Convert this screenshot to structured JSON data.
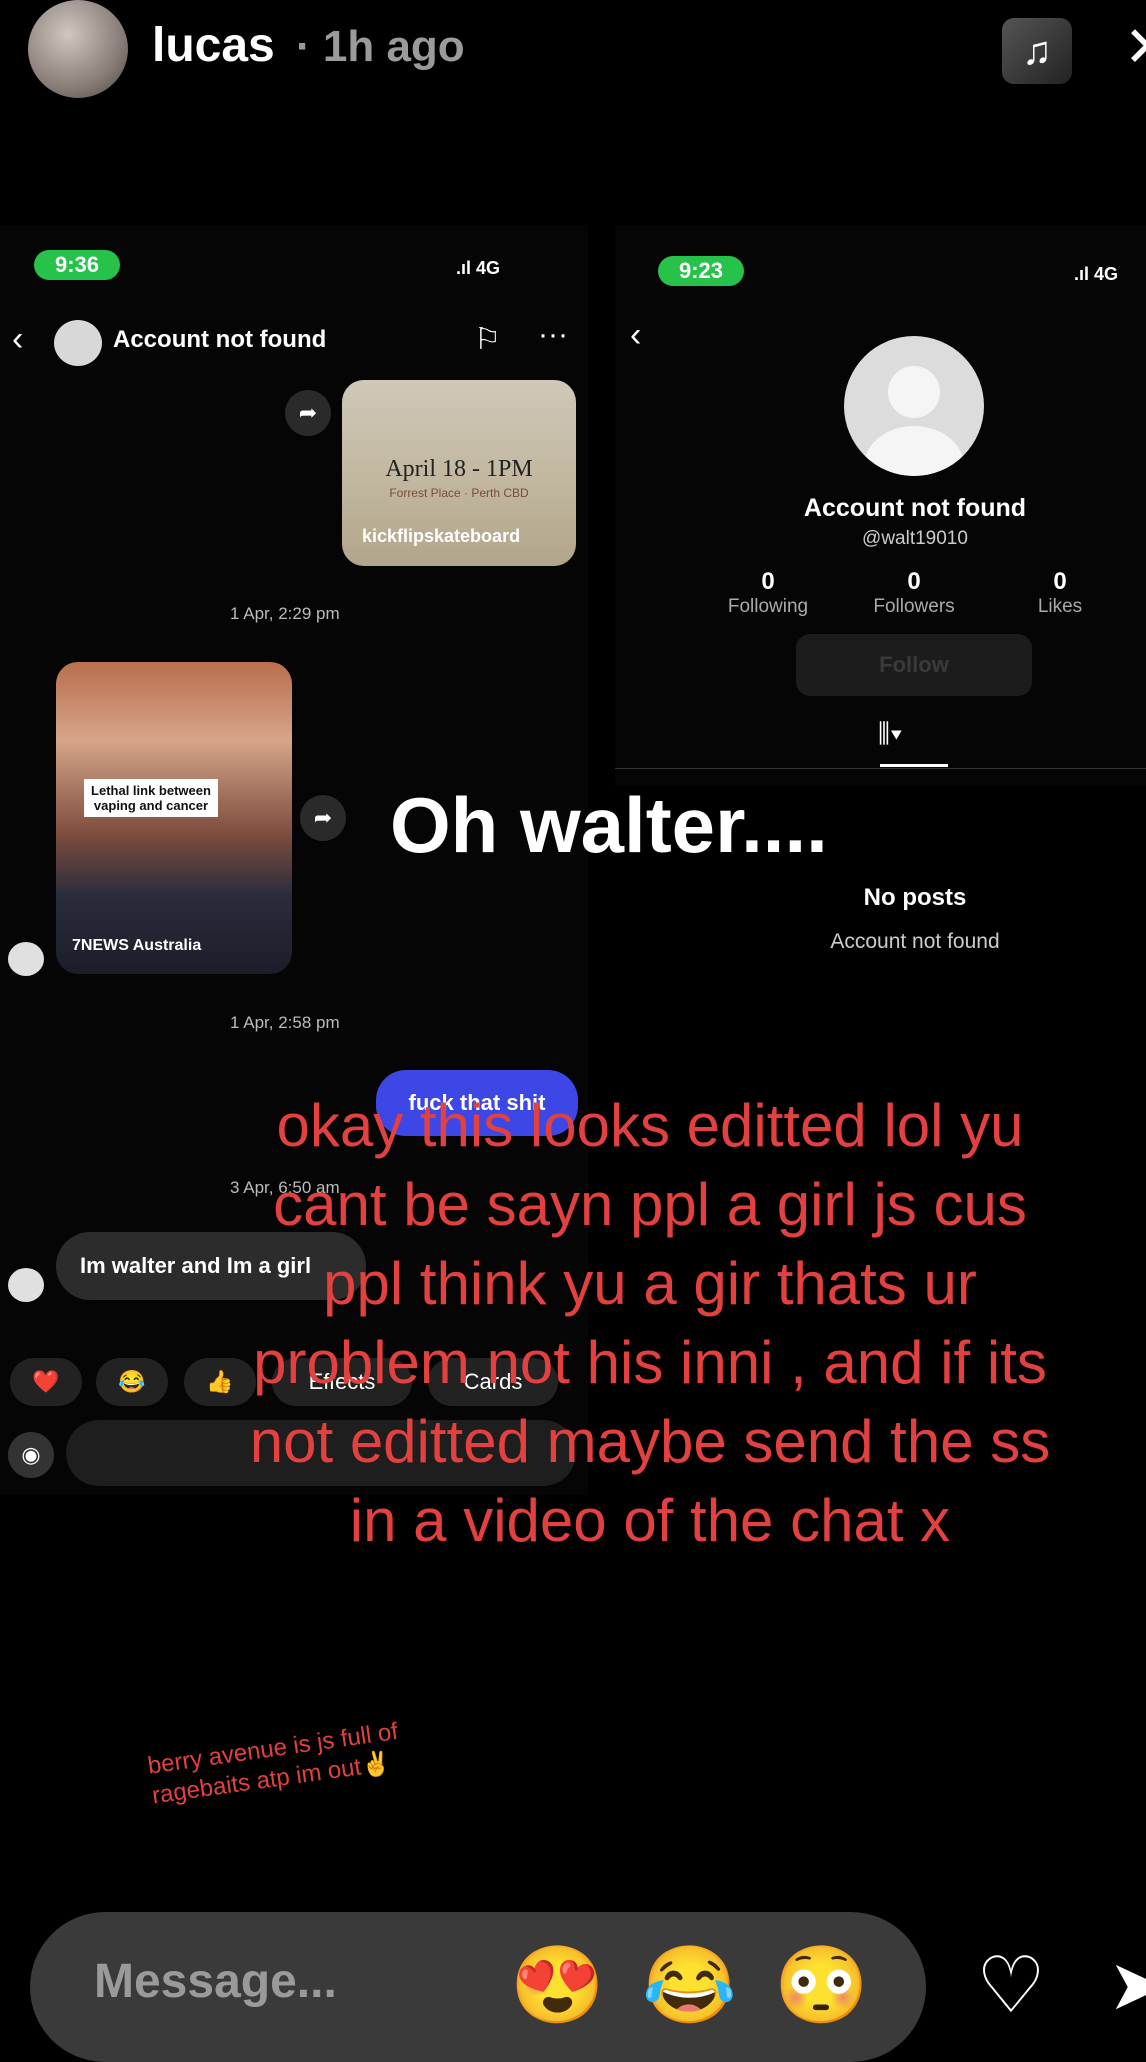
{
  "header": {
    "username": "lucas",
    "time": "· 1h ago",
    "music_icon": "music-note-icon",
    "close_icon": "close-icon"
  },
  "left_screenshot": {
    "status_time": "9:36",
    "status_signal": ".ıl 4G",
    "chat_title": "Account not found",
    "card1": {
      "event": "April 18 - 1PM",
      "place": "Forrest Place · Perth CBD",
      "handle": "kickflipskateboard"
    },
    "timestamp1": "1 Apr, 2:29 pm",
    "card2": {
      "caption": "Lethal link between vaping and cancer",
      "source": "7NEWS Australia"
    },
    "timestamp2": "1 Apr, 2:58 pm",
    "sent_message": "fuck that shit",
    "timestamp3": "3 Apr, 6:50 am",
    "received_message": "Im walter and Im a girl",
    "reactions": [
      "❤️",
      "😂",
      "👍",
      "Effects",
      "Cards"
    ]
  },
  "right_screenshot": {
    "status_time": "9:23",
    "status_signal": ".ıl 4G",
    "name": "Account not found",
    "handle": "@walt19010",
    "stats": [
      {
        "n": "0",
        "l": "Following"
      },
      {
        "n": "0",
        "l": "Followers"
      },
      {
        "n": "0",
        "l": "Likes"
      }
    ],
    "follow_label": "Follow",
    "no_posts": "No posts",
    "no_posts_sub": "Account not found"
  },
  "overlay": {
    "heading": "Oh walter....",
    "red_text": "okay this looks editted lol yu cant be sayn ppl a girl js cus ppl think yu a gir thats ur problem not his inni , and if its not editted maybe send the ss in a video of the chat x",
    "small_text": "berry avenue is js full of ragebaits atp im out✌️"
  },
  "message_bar": {
    "placeholder": "Message...",
    "emojis": [
      "😍",
      "😂",
      "😳"
    ]
  },
  "colors": {
    "accent_red": "#e2413f",
    "status_green": "#27c24a",
    "bubble_blue": "#3d47e6"
  }
}
